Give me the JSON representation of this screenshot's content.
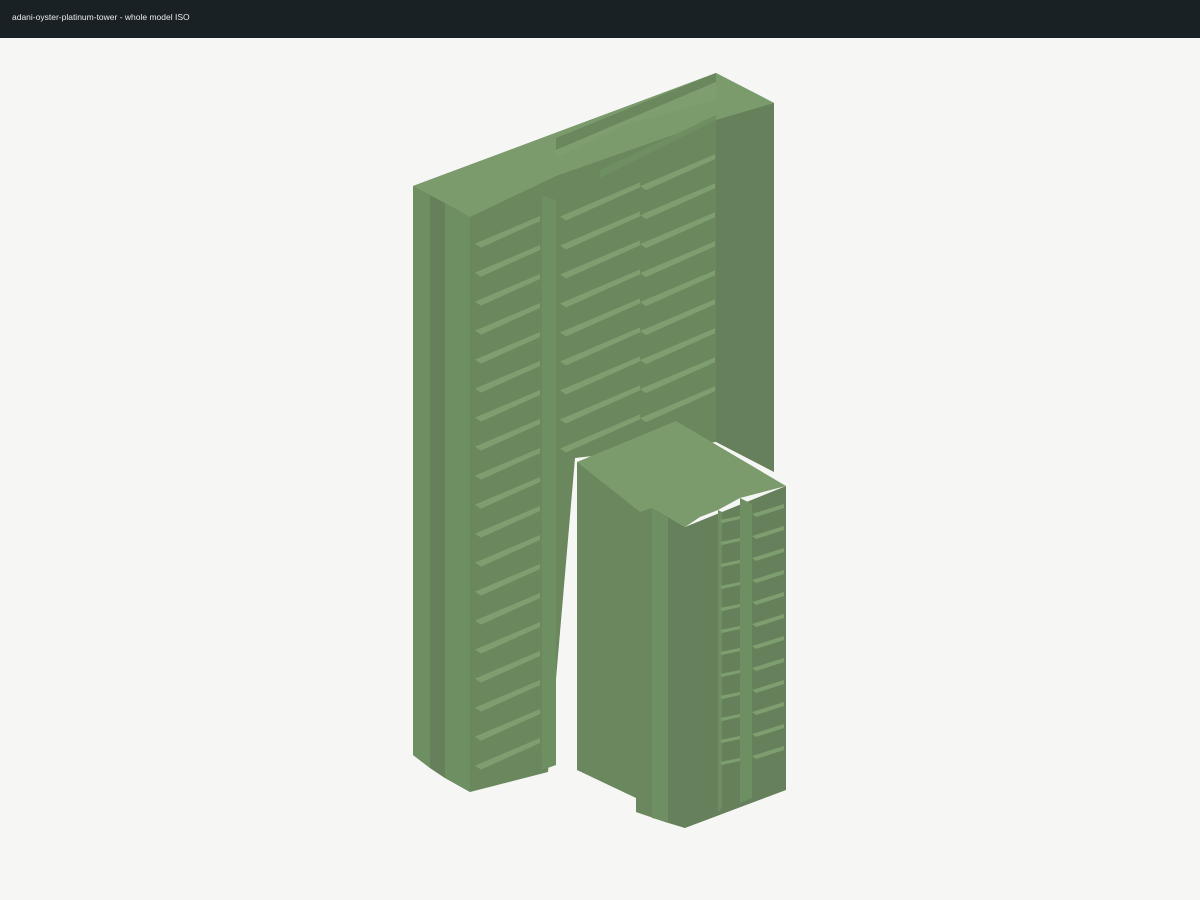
{
  "header": {
    "title": "adani-oyster-platinum-tower - whole model ISO"
  },
  "model": {
    "colors": {
      "background": "#f6f6f4",
      "titlebar": "#192125",
      "top_face": "#7b9b6d",
      "left_face": "#6e8f61",
      "front_face": "#6a875d",
      "right_face": "#65805a",
      "balcony_slab": "#7e9e70",
      "shadow": "#5f7a55"
    },
    "main_tower_floors": 19,
    "wing_floors": 12
  }
}
